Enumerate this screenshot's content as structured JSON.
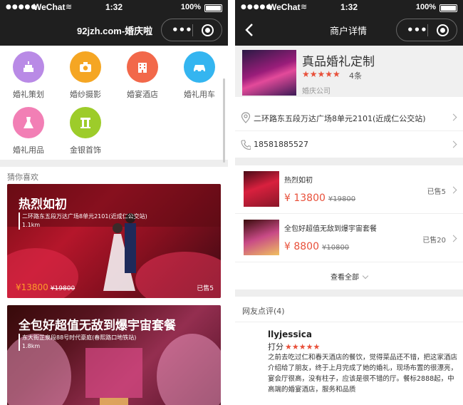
{
  "status": {
    "signal": "●●●●●",
    "carrier": "WeChat",
    "wifi": "≋",
    "time": "1:32",
    "battery": "100%"
  },
  "left": {
    "nav_title": "92jzh.com-婚庆啦",
    "capsule_dots": "•••",
    "categories": [
      {
        "label": "婚礼策划",
        "icon": "cake-icon",
        "color": "#b98ae6"
      },
      {
        "label": "婚纱摄影",
        "icon": "camera-icon",
        "color": "#f5a623"
      },
      {
        "label": "婚宴酒店",
        "icon": "hotel-icon",
        "color": "#f2684a"
      },
      {
        "label": "婚礼用车",
        "icon": "car-icon",
        "color": "#34b5f0"
      },
      {
        "label": "婚礼用品",
        "icon": "dress-icon",
        "color": "#f27fb5"
      },
      {
        "label": "金银首饰",
        "icon": "jewelry-icon",
        "color": "#9dcc2a"
      }
    ],
    "section_title": "猜你喜欢",
    "cards": [
      {
        "title": "热烈如初",
        "address": "二环路东五段万达广场8单元2101(近成仁公交站)",
        "distance": "1.1km",
        "price": "¥13800",
        "old_price": "¥19800",
        "sold": "已售5"
      },
      {
        "title": "全包好超值无敌到爆宇宙套餐",
        "address": "东大街芷泉段88号时代豪庭(春熙路口地铁站)",
        "distance": "1.8km",
        "price": "",
        "old_price": "",
        "sold": ""
      }
    ]
  },
  "right": {
    "nav_title": "商户详情",
    "capsule_dots": "•••",
    "shop": {
      "name": "真品婚礼定制",
      "stars": "★★★★★",
      "rating_count": "4条",
      "type": "婚庆公司"
    },
    "address": "二环路东五段万达广场8单元2101(近成仁公交站)",
    "phone": "18581885527",
    "products": [
      {
        "name": "热烈如初",
        "price": "¥ 13800",
        "old_price": "¥19800",
        "sold": "已售5"
      },
      {
        "name": "全包好超值无敌到爆宇宙套餐",
        "price": "¥ 8800",
        "old_price": "¥10800",
        "sold": "已售20"
      }
    ],
    "view_all": "查看全部",
    "reviews_title": "网友点评(4)",
    "review": {
      "user": "llyjessica",
      "score_label": "打分",
      "stars": "★★★★★",
      "text": "之前去吃过仁和春天酒店的餐饮，觉得菜品还不错，把这家酒店介绍给了朋友，终于上月完成了她的婚礼，现场布置的很漂亮，宴会厅很高，没有柱子，应该是很不错的厅。餐标2888起，中高端的婚宴酒店，服务和品质"
    }
  }
}
